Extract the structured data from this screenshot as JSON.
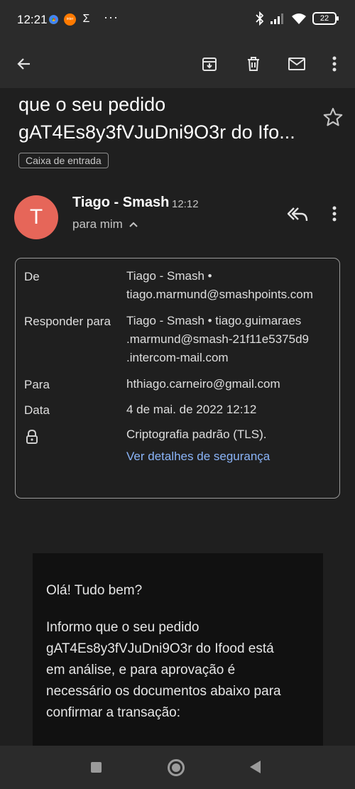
{
  "status_bar": {
    "time": "12:21",
    "app_labels": {
      "inter": "inter",
      "sigma": "Σ",
      "more": "···"
    },
    "battery": "22"
  },
  "toolbar": {
    "back_icon": "arrow-left-icon",
    "archive_icon": "archive-icon",
    "delete_icon": "trash-icon",
    "unread_icon": "mail-icon",
    "more_icon": "more-vert-icon"
  },
  "email": {
    "subject_lines": [
      "que o seu pedido",
      "gAT4Es8y3fVJuDni9O3r do Ifo..."
    ],
    "label": "Caixa de entrada",
    "sender_initial": "T",
    "sender_name": "Tiago - Smash",
    "time": "12:12",
    "to_summary": "para mim",
    "details": {
      "from_label": "De",
      "from_value": [
        "Tiago - Smash •",
        "tiago.marmund@smashpoints.com"
      ],
      "reply_label": "Responder para",
      "reply_value": [
        "Tiago - Smash • tiago.guimaraes",
        ".marmund@smash-21f11e5375d9",
        ".intercom-mail.com"
      ],
      "to_label": "Para",
      "to_value": "hthiago.carneiro@gmail.com",
      "date_label": "Data",
      "date_value": "4 de mai. de 2022 12:12",
      "security_value": "Criptografia padrão (TLS).",
      "security_link": "Ver detalhes de segurança"
    },
    "body": {
      "greeting": "Olá! Tudo bem?",
      "paragraph_lines": [
        "Informo que o seu pedido",
        "gAT4Es8y3fVJuDni9O3r do Ifood está",
        "em análise, e para aprovação é",
        "necessário os documentos abaixo para",
        "confirmar a transação:"
      ]
    }
  },
  "colors": {
    "background": "#1f1f1f",
    "bar": "#2b2b2b",
    "avatar": "#e66659",
    "link": "#8ab4f8"
  }
}
